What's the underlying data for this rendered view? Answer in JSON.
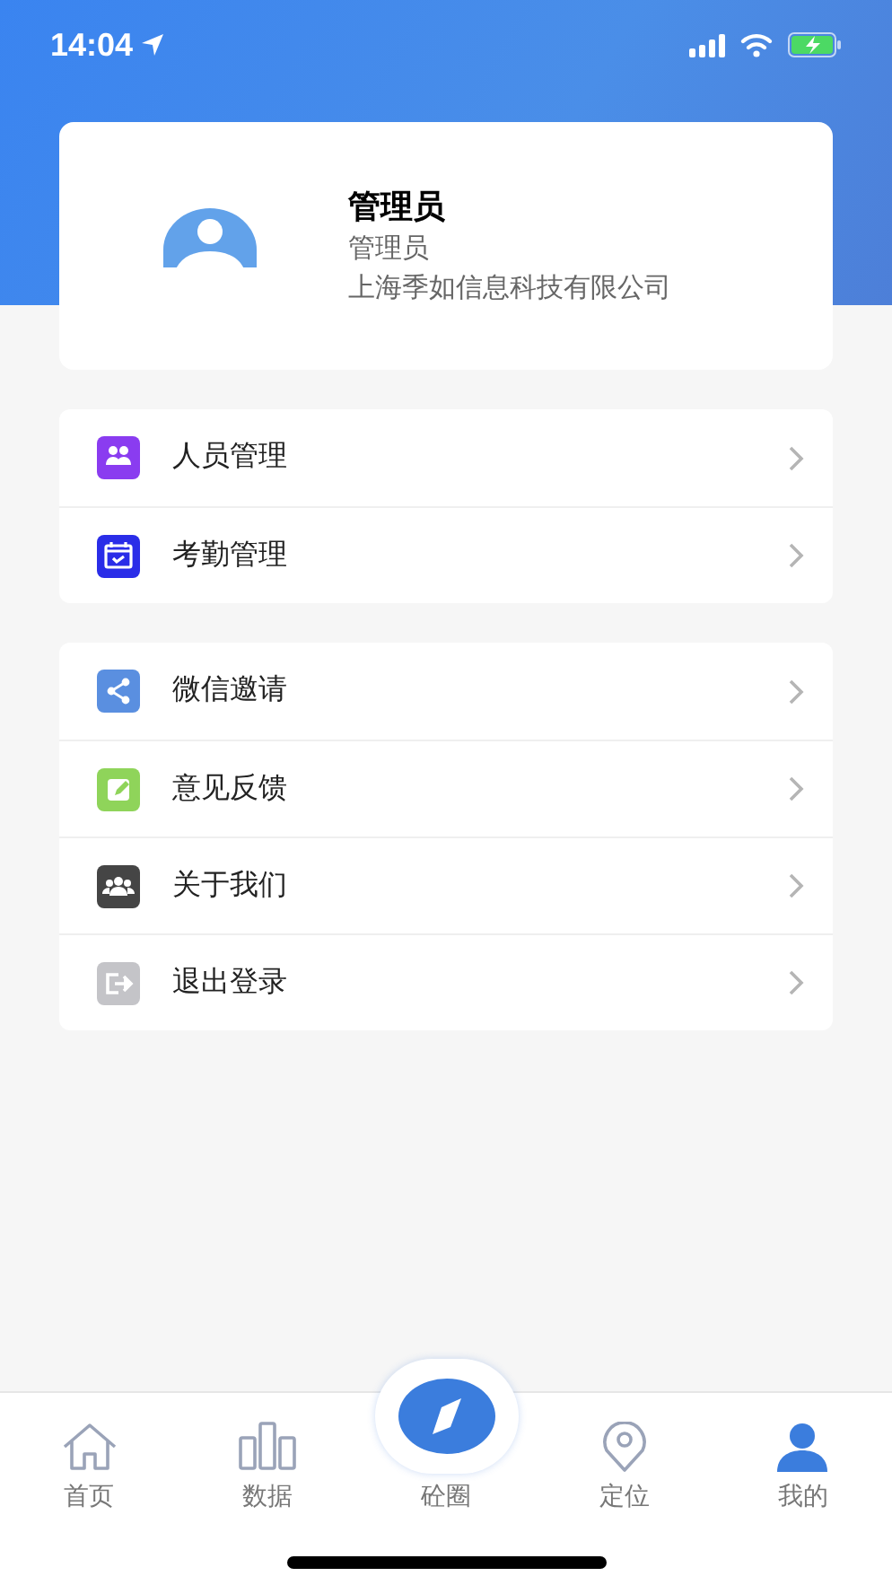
{
  "status_bar": {
    "time": "14:04"
  },
  "profile": {
    "name": "管理员",
    "role": "管理员",
    "company": "上海季如信息科技有限公司"
  },
  "menu_groups": [
    {
      "items": [
        {
          "label": "人员管理",
          "color": "#8a3cf0"
        },
        {
          "label": "考勤管理",
          "color": "#2a2de8"
        }
      ]
    },
    {
      "items": [
        {
          "label": "微信邀请",
          "color": "#5a8fe0"
        },
        {
          "label": "意见反馈",
          "color": "#8fd45a"
        },
        {
          "label": "关于我们",
          "color": "#454545"
        },
        {
          "label": "退出登录",
          "color": "#c4c4c8"
        }
      ]
    }
  ],
  "tab_bar": [
    {
      "label": "首页",
      "kind": "normal",
      "selected": false
    },
    {
      "label": "数据",
      "kind": "normal",
      "selected": false
    },
    {
      "label": "砼圈",
      "kind": "center",
      "selected": false
    },
    {
      "label": "定位",
      "kind": "normal",
      "selected": false
    },
    {
      "label": "我的",
      "kind": "normal",
      "selected": true
    }
  ]
}
